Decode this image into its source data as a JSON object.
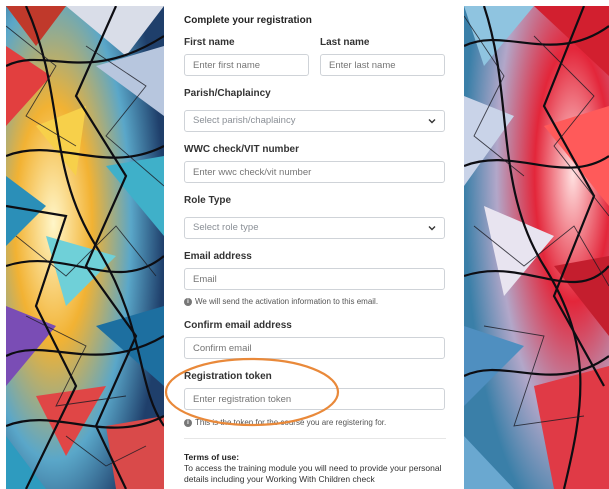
{
  "form": {
    "title": "Complete your registration",
    "first_name": {
      "label": "First name",
      "placeholder": "Enter first name"
    },
    "last_name": {
      "label": "Last name",
      "placeholder": "Enter last name"
    },
    "parish": {
      "label": "Parish/Chaplaincy",
      "selected": "Select parish/chaplaincy"
    },
    "wwc": {
      "label": "WWC check/VIT number",
      "placeholder": "Enter wwc check/vit number"
    },
    "role": {
      "label": "Role Type",
      "selected": "Select role type"
    },
    "email": {
      "label": "Email address",
      "placeholder": "Email",
      "help": "We will send the activation information to this email."
    },
    "confirm_email": {
      "label": "Confirm email address",
      "placeholder": "Confirm email"
    },
    "token": {
      "label": "Registration token",
      "placeholder": "Enter registration token",
      "help": "This is the token for the course you are registering for."
    },
    "terms": {
      "title": "Terms of use:",
      "text": "To access the training module you will need to provide your personal details including your Working With Children check"
    }
  },
  "colors": {
    "annotation": "#e9893a",
    "input_border": "#cfd3d8"
  }
}
